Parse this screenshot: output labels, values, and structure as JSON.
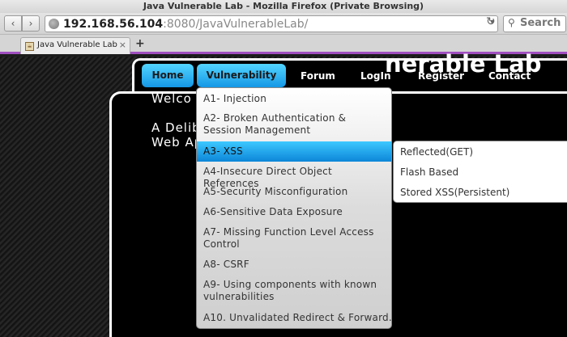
{
  "window": {
    "title": "Java Vulnerable Lab - Mozilla Firefox (Private Browsing)"
  },
  "toolbar": {
    "url_host": "192.168.56.104",
    "url_rest": ":8080/JavaVulnerableLab/",
    "search_placeholder": "Search"
  },
  "tabs": [
    {
      "label": "Java Vulnerable Lab"
    }
  ],
  "nav": {
    "items": [
      "Home",
      "Vulnerability",
      "Forum",
      "LogIn",
      "Register",
      "Contact"
    ]
  },
  "page": {
    "heading": "nerable Lab",
    "welcome": "Welco",
    "desc_line1": "A Delib",
    "desc_line2": "Web Ap"
  },
  "menu": {
    "items": [
      "A1- Injection",
      "A2- Broken Authentication & Session Management",
      "A3- XSS",
      "A4-Insecure Direct Object References",
      "A5-Security Misconfiguration",
      "A6-Sensitive Data Exposure",
      "A7- Missing Function Level Access Control",
      "A8- CSRF",
      "A9- Using components with known vulnerabilities",
      "A10. Unvalidated Redirect & Forward.."
    ],
    "active_index": 2
  },
  "submenu": {
    "items": [
      "Reflected(GET)",
      "Flash Based",
      "Stored XSS(Persistent)"
    ]
  },
  "colors": {
    "accent": "#1597e5",
    "tab_underline": "#a04fbf"
  }
}
